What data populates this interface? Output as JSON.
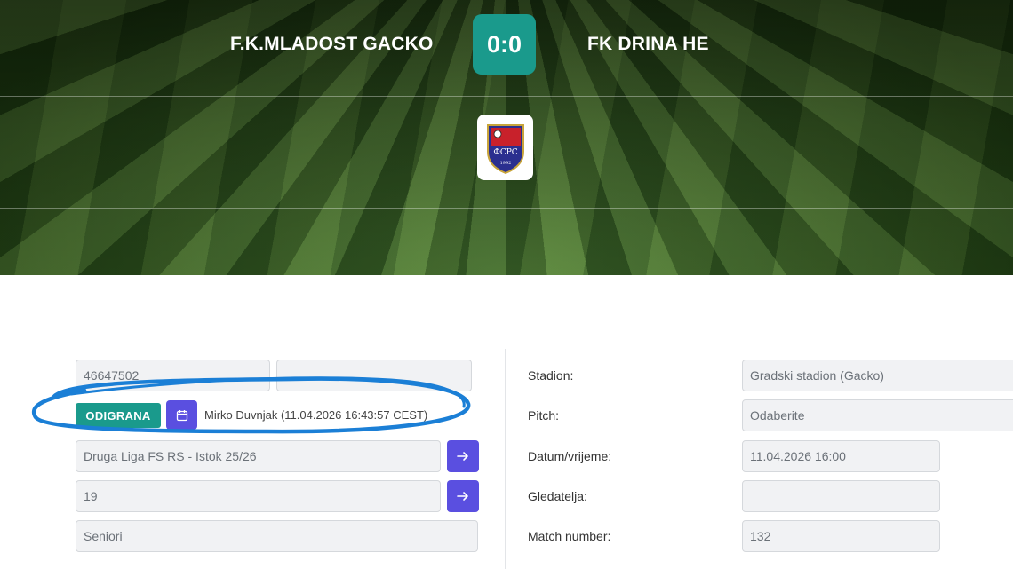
{
  "match": {
    "home_team": "F.K.MLADOST GACKO",
    "away_team": "FK DRINA HE",
    "score": "0:0"
  },
  "federation_logo": {
    "text": "ФСРС",
    "year": "1992"
  },
  "left_panel": {
    "match_id": "46647502",
    "field2": "",
    "status_badge": "ODIGRANA",
    "status_info": "Mirko Duvnjak (11.04.2026 16:43:57 CEST)",
    "league": "Druga Liga FS RS - Istok 25/26",
    "round": "19",
    "category": "Seniori"
  },
  "right_panel": {
    "stadion_label": "Stadion:",
    "stadion_value": "Gradski stadion (Gacko)",
    "pitch_label": "Pitch:",
    "pitch_value": "Odaberite",
    "datetime_label": "Datum/vrijeme:",
    "datetime_value": "11.04.2026 16:00",
    "spectators_label": "Gledatelja:",
    "spectators_value": "",
    "match_number_label": "Match number:",
    "match_number_value": "132"
  },
  "colors": {
    "accent_teal": "#1a9a8c",
    "accent_purple": "#5a4fe0",
    "annotation_blue": "#1b7fd6"
  }
}
